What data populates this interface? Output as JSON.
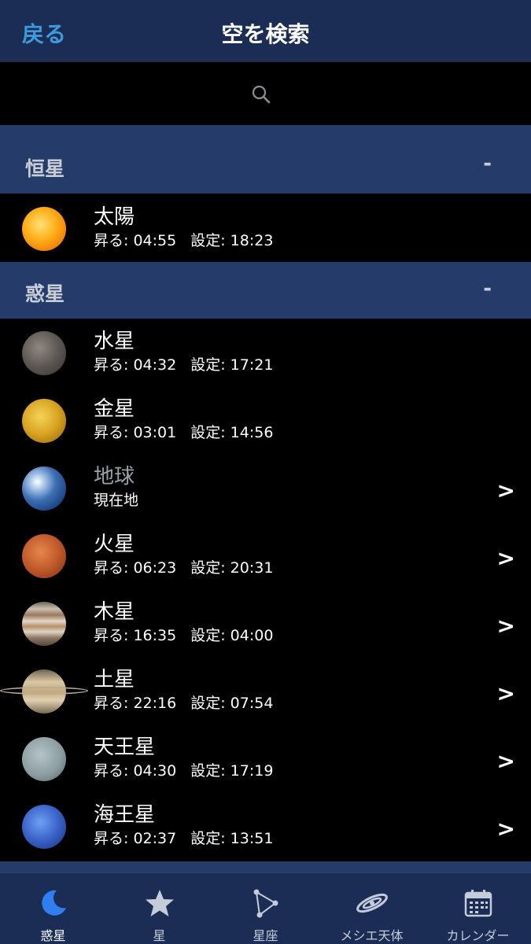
{
  "nav": {
    "back_label": "戻る",
    "title": "空を検索"
  },
  "search": {
    "icon": "search-icon"
  },
  "sections": [
    {
      "title": "恒星",
      "toggle": "-"
    },
    {
      "title": "惑星",
      "toggle": "-"
    }
  ],
  "labels": {
    "rise": "昇る: ",
    "set": "設定: "
  },
  "stars": [
    {
      "name": "太陽",
      "rise": "04:55",
      "set": "18:23"
    }
  ],
  "planets": [
    {
      "name": "水星",
      "rise": "04:32",
      "set": "17:21"
    },
    {
      "name": "金星",
      "rise": "03:01",
      "set": "14:56"
    },
    {
      "name": "地球",
      "sub": "現在地",
      "chevron": ">"
    },
    {
      "name": "火星",
      "rise": "06:23",
      "set": "20:31",
      "chevron": ">"
    },
    {
      "name": "木星",
      "rise": "16:35",
      "set": "04:00",
      "chevron": ">"
    },
    {
      "name": "土星",
      "rise": "22:16",
      "set": "07:54",
      "chevron": ">"
    },
    {
      "name": "天王星",
      "rise": "04:30",
      "set": "17:19",
      "chevron": ">"
    },
    {
      "name": "海王星",
      "rise": "02:37",
      "set": "13:51",
      "chevron": ">"
    }
  ],
  "tabs": [
    {
      "label": "惑星",
      "icon": "moon-icon",
      "active": true
    },
    {
      "label": "星",
      "icon": "star-icon"
    },
    {
      "label": "星座",
      "icon": "constellation-icon"
    },
    {
      "label": "メシエ天体",
      "icon": "galaxy-icon"
    },
    {
      "label": "カレンダー",
      "icon": "calendar-icon"
    }
  ],
  "colors": {
    "nav_bg": "#1b2c55",
    "section_bg": "#253c6b",
    "accent": "#3c9bdc"
  }
}
